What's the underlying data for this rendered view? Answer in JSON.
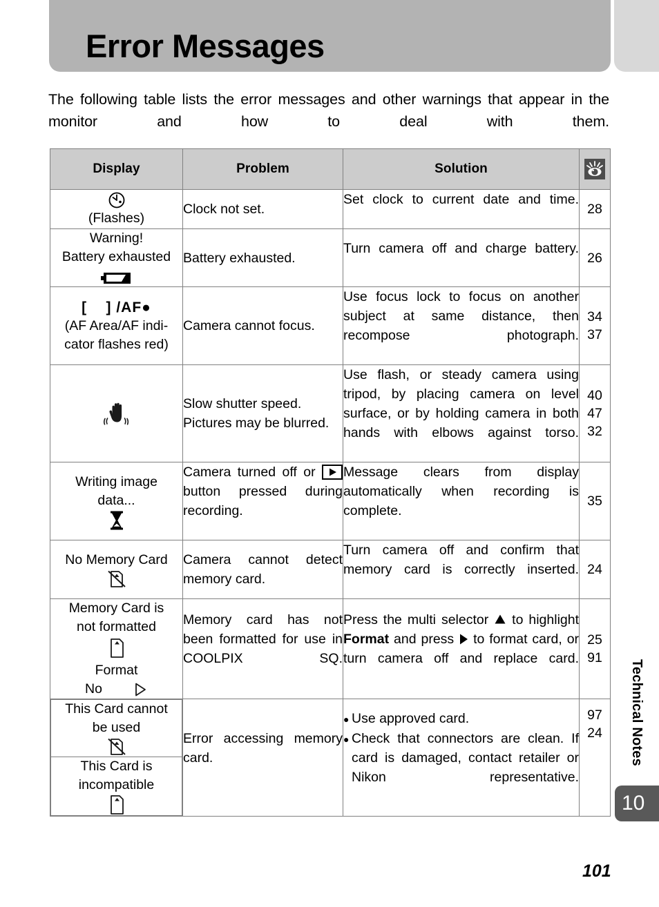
{
  "header": {
    "title": "Error Messages",
    "band_color": "#b3b3b3",
    "side_band_color": "#d8d8d8"
  },
  "intro": "The following table lists the error messages and other warnings that appear in the monitor and how to deal with them.",
  "table": {
    "columns": [
      "Display",
      "Problem",
      "Solution",
      "reference-icon"
    ],
    "header_icon": "eye-icon",
    "rows": [
      {
        "display_text": "(Flashes)",
        "display_icon": "clock-icon",
        "problem": "Clock not set.",
        "solution": "Set clock to current date and time.",
        "ref": "28"
      },
      {
        "display_line1": "Warning!",
        "display_line2": "Battery exhausted",
        "display_icon": "battery-empty-icon",
        "problem": "Battery exhausted.",
        "solution": "Turn camera off and charge battery.",
        "ref": "26"
      },
      {
        "display_symbol": "[    ] /AF",
        "display_line2": "(AF Area/AF indi-",
        "display_line3": "cator flashes red)",
        "problem": "Camera cannot focus.",
        "solution": "Use focus lock to focus on another subject at same distance, then recompose photograph.",
        "ref": "34\n37"
      },
      {
        "display_icon": "camera-shake-icon",
        "problem_line1": "Slow shutter speed.",
        "problem_line2": "Pictures may be blurred.",
        "solution": "Use flash, or steady camera using tripod, by placing camera on level surface, or by holding camera in both hands with elbows against torso.",
        "ref": "40\n47\n32"
      },
      {
        "display_line1": "Writing image",
        "display_line2": "data...",
        "display_icon": "hourglass-icon",
        "problem_pre": "Camera turned off or",
        "problem_icon": "playback-button-icon",
        "problem_post": "button pressed during recording.",
        "solution": "Message clears from display automatically when recording is complete.",
        "ref": "35"
      },
      {
        "display_line1": "No Memory Card",
        "display_icon": "no-memory-card-icon",
        "problem": "Camera cannot detect memory card.",
        "solution": "Turn camera off and confirm that memory card is correctly inserted.",
        "ref": "24"
      },
      {
        "display_line1": "Memory Card is",
        "display_line2": "not formatted",
        "display_icon": "memory-card-icon",
        "display_line3": "Format",
        "display_line4": "No",
        "display_icon2": "triangle-right-outline-icon",
        "problem": "Memory card has not been formatted for use in COOLPIX SQ.",
        "solution_pre": "Press the multi selector",
        "solution_icon1": "triangle-up-icon",
        "solution_mid": "to highlight",
        "solution_bold": "Format",
        "solution_mid2": "and press",
        "solution_icon2": "triangle-right-icon",
        "solution_post": "to format card, or turn camera off and replace card.",
        "ref": "25\n91"
      },
      {
        "display_sub1_line1": "This Card cannot",
        "display_sub1_line2": "be used",
        "display_sub1_icon": "no-memory-card-icon",
        "display_sub2_line1": "This Card is",
        "display_sub2_line2": "incompatible",
        "display_sub2_icon": "memory-card-icon",
        "problem": "Error accessing memory card.",
        "solution_bullets": [
          "Use approved card.",
          "Check that connectors are clean. If card is damaged, contact retailer or Nikon representative."
        ],
        "ref": "97\n24"
      }
    ]
  },
  "sidebar": {
    "chapter_label": "Technical Notes",
    "chapter_number": "10",
    "tab_color": "#595959"
  },
  "folio": "101"
}
